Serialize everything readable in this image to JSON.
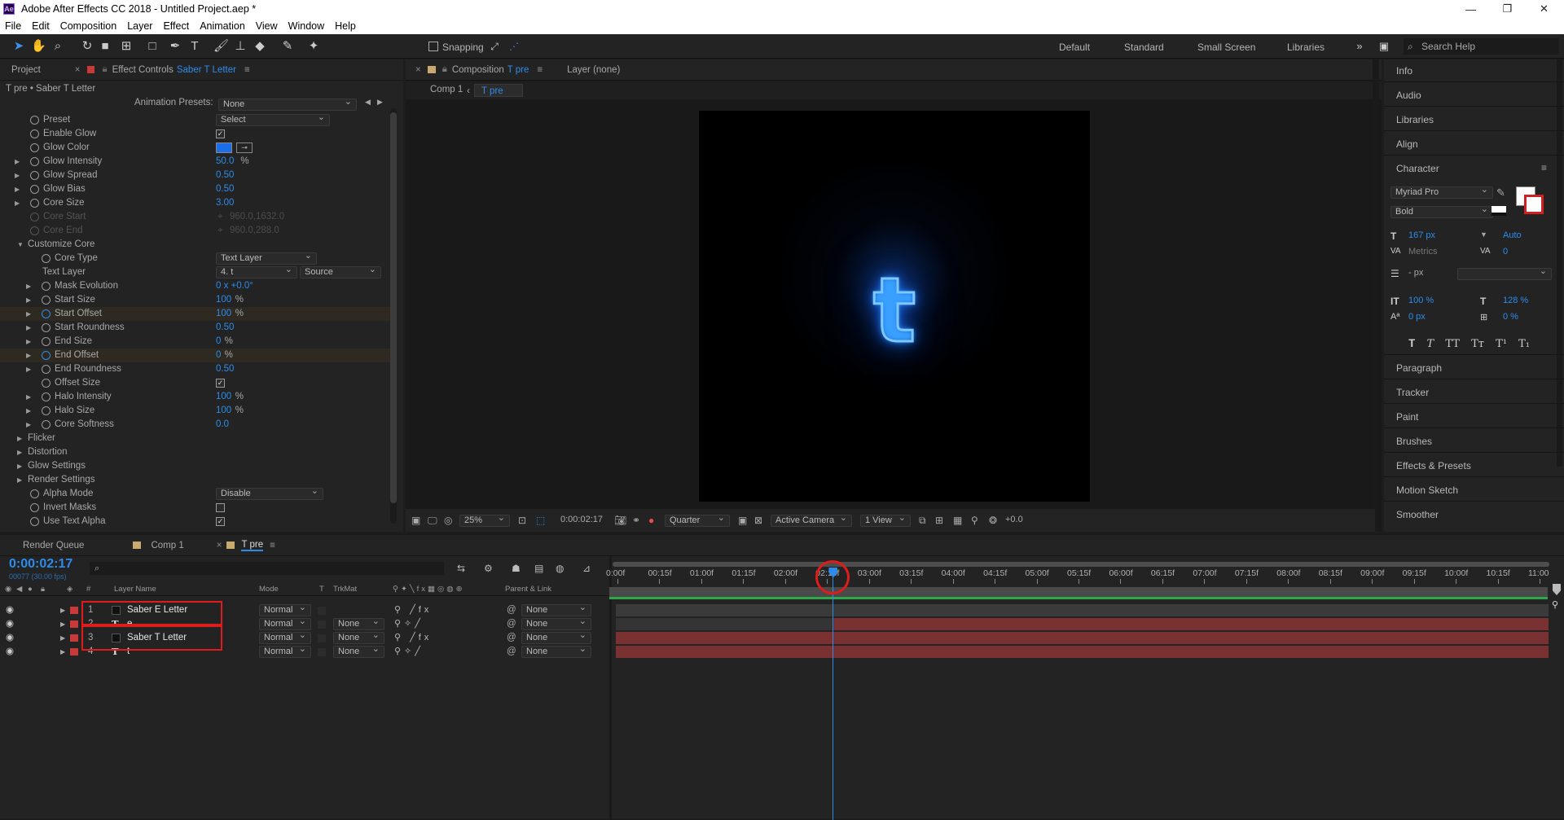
{
  "window": {
    "title": "Adobe After Effects CC 2018 - Untitled Project.aep *",
    "app_icon": "Ae"
  },
  "menu": [
    "File",
    "Edit",
    "Composition",
    "Layer",
    "Effect",
    "Animation",
    "View",
    "Window",
    "Help"
  ],
  "toolbar": {
    "snapping": "Snapping",
    "workspaces": [
      "Default",
      "Standard",
      "Small Screen",
      "Libraries"
    ],
    "search_help": "Search Help"
  },
  "effect_panel": {
    "tab_project": "Project",
    "tab_effect_prefix": "Effect Controls",
    "tab_effect_layer": "Saber T Letter",
    "header": "T pre • Saber T Letter",
    "animation_presets_label": "Animation Presets:",
    "animation_presets_value": "None",
    "params": [
      {
        "label": "Preset",
        "type": "dropdown",
        "value": "Select"
      },
      {
        "label": "Enable Glow",
        "type": "checkbox",
        "checked": true
      },
      {
        "label": "Glow Color",
        "type": "color",
        "value": "#1b6de8"
      },
      {
        "label": "Glow Intensity",
        "value": "50.0",
        "unit": "%"
      },
      {
        "label": "Glow Spread",
        "value": "0.50"
      },
      {
        "label": "Glow Bias",
        "value": "0.50"
      },
      {
        "label": "Core Size",
        "value": "3.00"
      },
      {
        "label": "Core Start",
        "value": "960.0,1632.0",
        "disabled": true
      },
      {
        "label": "Core End",
        "value": "960.0,288.0",
        "disabled": true
      },
      {
        "label": "Customize Core",
        "type": "group"
      },
      {
        "label": "Core Type",
        "type": "dropdown",
        "value": "Text Layer"
      },
      {
        "label": "Text Layer",
        "type": "dual",
        "value": "4. t",
        "value2": "Source"
      },
      {
        "label": "Mask Evolution",
        "value": "0 x +0.0°"
      },
      {
        "label": "Start Size",
        "value": "100",
        "unit": "%"
      },
      {
        "label": "Start Offset",
        "value": "100",
        "unit": "%"
      },
      {
        "label": "Start Roundness",
        "value": "0.50"
      },
      {
        "label": "End Size",
        "value": "0",
        "unit": "%"
      },
      {
        "label": "End Offset",
        "value": "0",
        "unit": "%"
      },
      {
        "label": "End Roundness",
        "value": "0.50"
      },
      {
        "label": "Offset Size",
        "type": "checkbox",
        "checked": true
      },
      {
        "label": "Halo Intensity",
        "value": "100",
        "unit": "%"
      },
      {
        "label": "Halo Size",
        "value": "100",
        "unit": "%"
      },
      {
        "label": "Core Softness",
        "value": "0.0"
      },
      {
        "label": "Flicker",
        "type": "group"
      },
      {
        "label": "Distortion",
        "type": "group"
      },
      {
        "label": "Glow Settings",
        "type": "group"
      },
      {
        "label": "Render Settings",
        "type": "group"
      },
      {
        "label": "Alpha Mode",
        "type": "dropdown",
        "value": "Disable"
      },
      {
        "label": "Invert Masks",
        "type": "checkbox",
        "checked": false
      },
      {
        "label": "Use Text Alpha",
        "type": "checkbox",
        "checked": true
      }
    ]
  },
  "comp_panel": {
    "tab_prefix": "Composition",
    "tab_name": "T pre",
    "layer_tab": "Layer (none)",
    "breadcrumb_1": "Comp 1",
    "breadcrumb_2": "T pre",
    "preview_letter": "t",
    "controls": {
      "zoom": "25%",
      "timecode": "0:00:02:17",
      "resolution": "Quarter",
      "camera": "Active Camera",
      "views": "1 View",
      "exposure": "+0.0"
    }
  },
  "right_panel": {
    "items": [
      "Info",
      "Audio",
      "Libraries",
      "Align",
      "Character",
      "Paragraph",
      "Tracker",
      "Paint",
      "Brushes",
      "Effects & Presets",
      "Motion Sketch",
      "Smoother"
    ],
    "character": {
      "font": "Myriad Pro",
      "style": "Bold",
      "size": "167 px",
      "leading": "Auto",
      "kerning": "Metrics",
      "tracking": "0",
      "stroke": "- px",
      "vscale": "100 %",
      "hscale": "128 %",
      "baseline": "0 px",
      "tsume": "0 %"
    }
  },
  "timeline": {
    "tabs": [
      "Render Queue",
      "Comp 1",
      "T pre"
    ],
    "timecode": "0:00:02:17",
    "frames": "00077 (30.00 fps)",
    "columns": {
      "layer_name": "Layer Name",
      "mode": "Mode",
      "t": "T",
      "trkmat": "TrkMat",
      "parent": "Parent & Link"
    },
    "layers": [
      {
        "num": "1",
        "type": "solid",
        "name": "Saber E Letter",
        "mode": "Normal",
        "trkmat": "",
        "parent": "None"
      },
      {
        "num": "2",
        "type": "text",
        "name": "e",
        "mode": "Normal",
        "trkmat": "None",
        "parent": "None"
      },
      {
        "num": "3",
        "type": "solid",
        "name": "Saber T Letter",
        "mode": "Normal",
        "trkmat": "None",
        "parent": "None"
      },
      {
        "num": "4",
        "type": "text",
        "name": "t",
        "mode": "Normal",
        "trkmat": "None",
        "parent": "None"
      }
    ],
    "ticks": [
      "0:00f",
      "00:15f",
      "01:00f",
      "01:15f",
      "02:00f",
      "02:15f",
      "03:00f",
      "03:15f",
      "04:00f",
      "04:15f",
      "05:00f",
      "05:15f",
      "06:00f",
      "06:15f",
      "07:00f",
      "07:15f",
      "08:00f",
      "08:15f",
      "09:00f",
      "09:15f",
      "10:00f",
      "10:15f",
      "11:00"
    ],
    "playhead_seconds": 2.57,
    "duration_seconds": 11.0
  }
}
